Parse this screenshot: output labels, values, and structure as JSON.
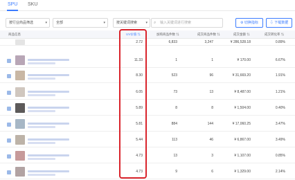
{
  "tabs": [
    {
      "label": "SPU",
      "active": true
    },
    {
      "label": "SKU",
      "active": false
    }
  ],
  "filters": {
    "industry_label": "按行业商品筛选",
    "scope_label": "全部",
    "keyword_mode_label": "按关键词搜索",
    "search_placeholder": "输入关键词进行搜索",
    "switch_button": "切换指标",
    "download_button": "下载数据"
  },
  "columns": {
    "product": "商品信息",
    "uv_value": "UV价值",
    "cart_count": "加购商品件数",
    "sold_count": "成交商品件数",
    "gmv": "成交金额",
    "conversion": "成交转化率"
  },
  "rows": [
    {
      "uv": "2.72",
      "cart": "6,833",
      "sold": "3,247",
      "gmv": "¥ 286,528.18",
      "conv": "0.89%",
      "thumb": "#e4e4e4"
    },
    {
      "uv": "11.33",
      "cart": "1",
      "sold": "1",
      "gmv": "¥ 170.00",
      "conv": "6.67%",
      "thumb": "#b8a6b6"
    },
    {
      "uv": "8.30",
      "cart": "523",
      "sold": "96",
      "gmv": "¥ 31,669.20",
      "conv": "1.91%",
      "thumb": "#c9b7a4"
    },
    {
      "uv": "6.05",
      "cart": "73",
      "sold": "13",
      "gmv": "¥ 8,487.00",
      "conv": "1.21%",
      "thumb": "#d0c7bf"
    },
    {
      "uv": "5.89",
      "cart": "8",
      "sold": "8",
      "gmv": "¥ 1,504.00",
      "conv": "0.40%",
      "thumb": "#5d5a5a"
    },
    {
      "uv": "5.81",
      "cart": "884",
      "sold": "144",
      "gmv": "¥ 17,060.25",
      "conv": "3.47%",
      "thumb": "#a7b7c6"
    },
    {
      "uv": "5.44",
      "cart": "113",
      "sold": "46",
      "gmv": "¥ 6,867.00",
      "conv": "3.49%",
      "thumb": "#bdb3a8"
    },
    {
      "uv": "4.73",
      "cart": "13",
      "sold": "3",
      "gmv": "¥ 1,107.00",
      "conv": "0.85%",
      "thumb": "#c79a9a"
    },
    {
      "uv": "4.73",
      "cart": "9",
      "sold": "6",
      "gmv": "¥ 1,329.00",
      "conv": "2.14%",
      "thumb": "#b2a3a3"
    }
  ],
  "colors": {
    "accent": "#3b7cff",
    "highlight": "#d9232b"
  }
}
